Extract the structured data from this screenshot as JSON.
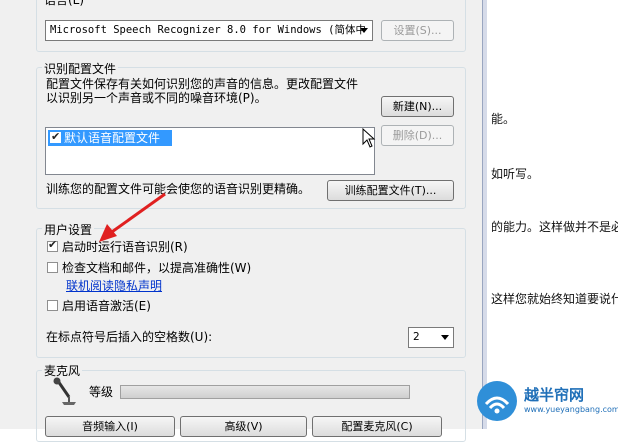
{
  "language": {
    "group_title": "语言(L)",
    "recognizer_value": "Microsoft Speech Recognizer 8.0 for Windows (简体中",
    "settings_button": "设置(S)..."
  },
  "profiles": {
    "group_title": "识别配置文件",
    "desc_line1": "配置文件保存有关如何识别您的声音的信息。更改配置文件",
    "desc_line2": "以识别另一个声音或不同的噪音环境(P)。",
    "new_button": "新建(N)...",
    "delete_button": "删除(D)...",
    "items": [
      "默认语音配置文件"
    ],
    "train_text": "训练您的配置文件可能会使您的语音识别更精确。",
    "train_button": "训练配置文件(T)..."
  },
  "user_settings": {
    "group_title": "用户设置",
    "run_at_startup": "启动时运行语音识别(R)",
    "review_docs": "检查文档和邮件，以提高准确性(W)",
    "privacy_link": "联机阅读隐私声明",
    "voice_activation": "启用语音激活(E)",
    "spaces_label": "在标点符号后插入的空格数(U):",
    "spaces_value": "2"
  },
  "microphone": {
    "group_title": "麦克风",
    "level_label": "等级",
    "audio_input_button": "音频输入(I)",
    "advanced_button": "高级(V)",
    "configure_button": "配置麦克风(C)"
  },
  "background_doc": {
    "lines": [
      "能。",
      "如听写。",
      "的能力。这样做并不是必",
      "这样您就始终知道要说什"
    ]
  },
  "watermark": {
    "name": "越半帘网",
    "url": "www.yueyangbang.com"
  },
  "colors": {
    "annotation_arrow": "#e02020",
    "selection": "#3399ff",
    "link": "#0033cc"
  }
}
